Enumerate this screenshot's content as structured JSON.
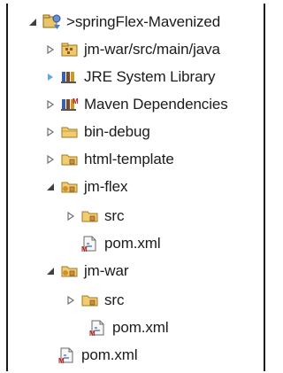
{
  "tree": {
    "items": [
      {
        "label": ">springFlex-Mavenized",
        "twisty": "expanded",
        "icon": "project-icon",
        "level": 0
      },
      {
        "label": "jm-war/src/main/java",
        "twisty": "collapsed",
        "icon": "source-folder-icon",
        "level": 1
      },
      {
        "label": "JRE System Library",
        "twisty": "collapsed-blue",
        "icon": "library-icon",
        "level": 1
      },
      {
        "label": "Maven Dependencies",
        "twisty": "collapsed",
        "icon": "maven-library-icon",
        "level": 1
      },
      {
        "label": "bin-debug",
        "twisty": "collapsed",
        "icon": "folder-icon",
        "level": 1
      },
      {
        "label": "html-template",
        "twisty": "collapsed",
        "icon": "package-folder-icon",
        "level": 1
      },
      {
        "label": "jm-flex",
        "twisty": "expanded",
        "icon": "module-folder-icon",
        "level": 1
      },
      {
        "label": "src",
        "twisty": "collapsed",
        "icon": "package-folder-icon",
        "level": 2
      },
      {
        "label": "pom.xml",
        "twisty": "none",
        "icon": "xml-file-icon",
        "level": 2
      },
      {
        "label": "jm-war",
        "twisty": "expanded",
        "icon": "module-folder-icon",
        "level": 1
      },
      {
        "label": "src",
        "twisty": "collapsed",
        "icon": "package-folder-icon",
        "level": 2
      },
      {
        "label": "pom.xml",
        "twisty": "none",
        "icon": "xml-file-icon",
        "level": 2
      },
      {
        "label": "pom.xml",
        "twisty": "none",
        "icon": "xml-file-icon",
        "level": 1
      }
    ]
  }
}
